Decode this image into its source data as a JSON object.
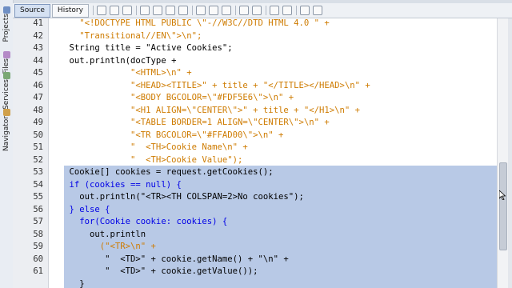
{
  "toolbar": {
    "source_label": "Source",
    "history_label": "History"
  },
  "side_tabs": [
    {
      "label": "Projects",
      "icon": "projects-icon"
    },
    {
      "label": "Files",
      "icon": "files-icon"
    },
    {
      "label": "Services",
      "icon": "services-icon"
    },
    {
      "label": "Navigator",
      "icon": "navigator-icon"
    }
  ],
  "editor": {
    "line_numbers": [
      "41",
      "42",
      "43",
      "44",
      "45",
      "46",
      "47",
      "48",
      "49",
      "50",
      "51",
      "52",
      "53",
      "54",
      "55",
      "56",
      "57",
      "58",
      "59",
      "60",
      "61"
    ],
    "lines": [
      "      \"<!DOCTYPE HTML PUBLIC \\\"-//W3C//DTD HTML 4.0 \" +",
      "      \"Transitional//EN\\\">\\n\";",
      "    String title = \"Active Cookies\";",
      "    out.println(docType +",
      "                \"<HTML>\\n\" +",
      "                \"<HEAD><TITLE>\" + title + \"</TITLE></HEAD>\\n\" +",
      "                \"<BODY BGCOLOR=\\\"#FDF5E6\\\">\\n\" +",
      "                \"<H1 ALIGN=\\\"CENTER\\\">\" + title + \"</H1>\\n\" +",
      "                \"<TABLE BORDER=1 ALIGN=\\\"CENTER\\\">\\n\" +",
      "                \"<TR BGCOLOR=\\\"#FFAD00\\\">\\n\" +",
      "                \"  <TH>Cookie Name\\n\" +",
      "                \"  <TH>Cookie Value\");",
      "    Cookie[] cookies = request.getCookies();",
      "    if (cookies == null) {",
      "      out.println(\"<TR><TH COLSPAN=2>No cookies\");",
      "    } else {",
      "      for(Cookie cookie: cookies) {",
      "        out.println",
      "          (\"<TR>\\n\" +",
      "           \"  <TD>\" + cookie.getName() + \"\\n\" +",
      "           \"  <TD>\" + cookie.getValue());",
      "      }"
    ]
  },
  "colors": {
    "string": "#ce7b00",
    "keyword": "#0000e6",
    "selection": "#b8c9e6"
  }
}
